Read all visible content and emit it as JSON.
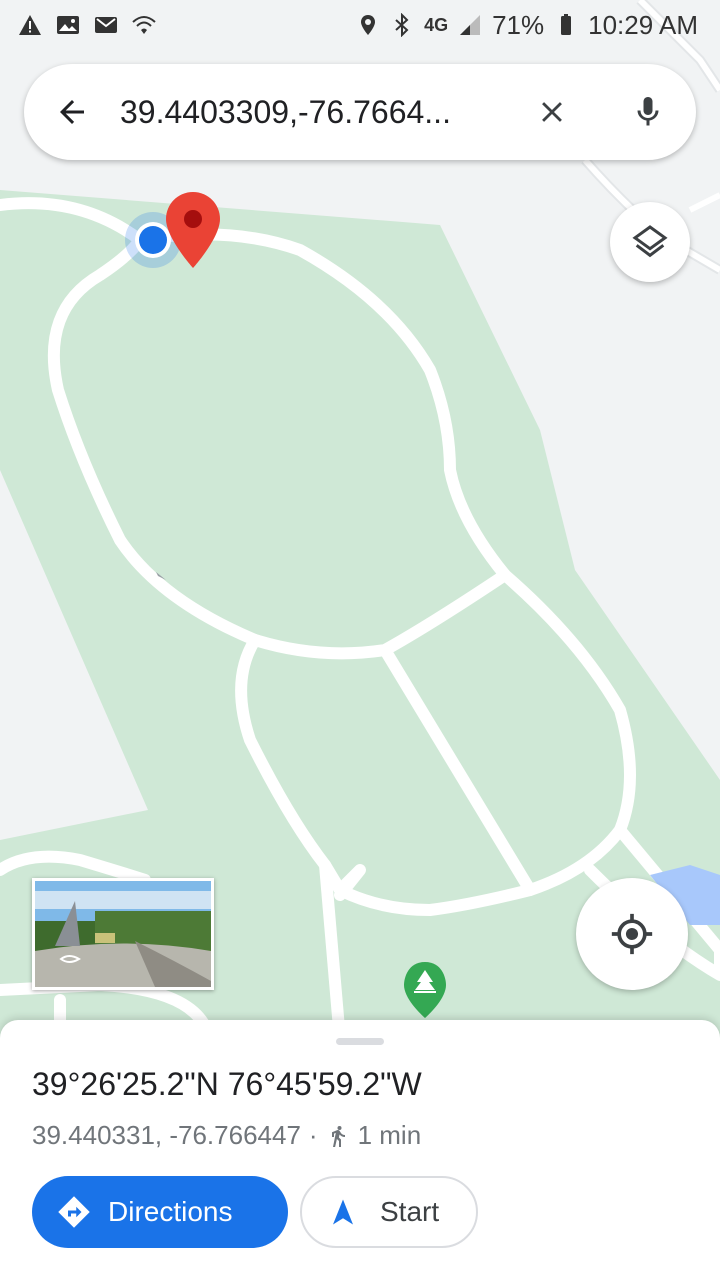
{
  "status_bar": {
    "network": "4G",
    "battery": "71%",
    "time": "10:29 AM",
    "icons_left": [
      "warning-icon",
      "image-icon",
      "mail-icon",
      "wifi-icon"
    ],
    "icons_right": [
      "location-icon",
      "bluetooth-icon",
      "4g-lte-icon",
      "signal-icon",
      "battery-icon"
    ]
  },
  "search": {
    "value": "39.4403309,-76.7664...",
    "back_icon": "arrow-left-icon",
    "clear_icon": "close-icon",
    "mic_icon": "mic-icon"
  },
  "map": {
    "background": "#f1f3f4",
    "park_color": "#cfe8d6",
    "road_color": "#ffffff",
    "water_color": "#a8c8fb"
  },
  "sheet": {
    "title": "39°26'25.2\"N 76°45'59.2\"W",
    "coords": "39.440331, -76.766447",
    "separator": "·",
    "walk_time": "1 min",
    "directions_label": "Directions",
    "start_label": "Start"
  },
  "colors": {
    "accent": "#1a73e8",
    "pin": "#ea4335",
    "location_dot": "#1a73e8"
  }
}
